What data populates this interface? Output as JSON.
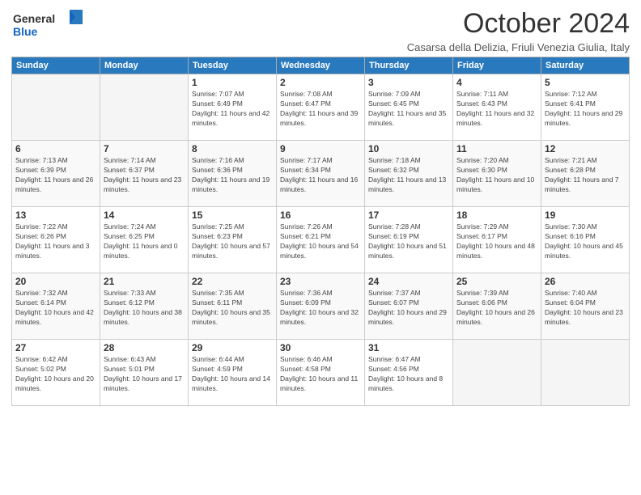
{
  "logo": {
    "general": "General",
    "blue": "Blue"
  },
  "title": "October 2024",
  "location": "Casarsa della Delizia, Friuli Venezia Giulia, Italy",
  "days_of_week": [
    "Sunday",
    "Monday",
    "Tuesday",
    "Wednesday",
    "Thursday",
    "Friday",
    "Saturday"
  ],
  "weeks": [
    [
      {
        "day": "",
        "sunrise": "",
        "sunset": "",
        "daylight": "",
        "empty": true
      },
      {
        "day": "",
        "sunrise": "",
        "sunset": "",
        "daylight": "",
        "empty": true
      },
      {
        "day": "1",
        "sunrise": "Sunrise: 7:07 AM",
        "sunset": "Sunset: 6:49 PM",
        "daylight": "Daylight: 11 hours and 42 minutes."
      },
      {
        "day": "2",
        "sunrise": "Sunrise: 7:08 AM",
        "sunset": "Sunset: 6:47 PM",
        "daylight": "Daylight: 11 hours and 39 minutes."
      },
      {
        "day": "3",
        "sunrise": "Sunrise: 7:09 AM",
        "sunset": "Sunset: 6:45 PM",
        "daylight": "Daylight: 11 hours and 35 minutes."
      },
      {
        "day": "4",
        "sunrise": "Sunrise: 7:11 AM",
        "sunset": "Sunset: 6:43 PM",
        "daylight": "Daylight: 11 hours and 32 minutes."
      },
      {
        "day": "5",
        "sunrise": "Sunrise: 7:12 AM",
        "sunset": "Sunset: 6:41 PM",
        "daylight": "Daylight: 11 hours and 29 minutes."
      }
    ],
    [
      {
        "day": "6",
        "sunrise": "Sunrise: 7:13 AM",
        "sunset": "Sunset: 6:39 PM",
        "daylight": "Daylight: 11 hours and 26 minutes."
      },
      {
        "day": "7",
        "sunrise": "Sunrise: 7:14 AM",
        "sunset": "Sunset: 6:37 PM",
        "daylight": "Daylight: 11 hours and 23 minutes."
      },
      {
        "day": "8",
        "sunrise": "Sunrise: 7:16 AM",
        "sunset": "Sunset: 6:36 PM",
        "daylight": "Daylight: 11 hours and 19 minutes."
      },
      {
        "day": "9",
        "sunrise": "Sunrise: 7:17 AM",
        "sunset": "Sunset: 6:34 PM",
        "daylight": "Daylight: 11 hours and 16 minutes."
      },
      {
        "day": "10",
        "sunrise": "Sunrise: 7:18 AM",
        "sunset": "Sunset: 6:32 PM",
        "daylight": "Daylight: 11 hours and 13 minutes."
      },
      {
        "day": "11",
        "sunrise": "Sunrise: 7:20 AM",
        "sunset": "Sunset: 6:30 PM",
        "daylight": "Daylight: 11 hours and 10 minutes."
      },
      {
        "day": "12",
        "sunrise": "Sunrise: 7:21 AM",
        "sunset": "Sunset: 6:28 PM",
        "daylight": "Daylight: 11 hours and 7 minutes."
      }
    ],
    [
      {
        "day": "13",
        "sunrise": "Sunrise: 7:22 AM",
        "sunset": "Sunset: 6:26 PM",
        "daylight": "Daylight: 11 hours and 3 minutes."
      },
      {
        "day": "14",
        "sunrise": "Sunrise: 7:24 AM",
        "sunset": "Sunset: 6:25 PM",
        "daylight": "Daylight: 11 hours and 0 minutes."
      },
      {
        "day": "15",
        "sunrise": "Sunrise: 7:25 AM",
        "sunset": "Sunset: 6:23 PM",
        "daylight": "Daylight: 10 hours and 57 minutes."
      },
      {
        "day": "16",
        "sunrise": "Sunrise: 7:26 AM",
        "sunset": "Sunset: 6:21 PM",
        "daylight": "Daylight: 10 hours and 54 minutes."
      },
      {
        "day": "17",
        "sunrise": "Sunrise: 7:28 AM",
        "sunset": "Sunset: 6:19 PM",
        "daylight": "Daylight: 10 hours and 51 minutes."
      },
      {
        "day": "18",
        "sunrise": "Sunrise: 7:29 AM",
        "sunset": "Sunset: 6:17 PM",
        "daylight": "Daylight: 10 hours and 48 minutes."
      },
      {
        "day": "19",
        "sunrise": "Sunrise: 7:30 AM",
        "sunset": "Sunset: 6:16 PM",
        "daylight": "Daylight: 10 hours and 45 minutes."
      }
    ],
    [
      {
        "day": "20",
        "sunrise": "Sunrise: 7:32 AM",
        "sunset": "Sunset: 6:14 PM",
        "daylight": "Daylight: 10 hours and 42 minutes."
      },
      {
        "day": "21",
        "sunrise": "Sunrise: 7:33 AM",
        "sunset": "Sunset: 6:12 PM",
        "daylight": "Daylight: 10 hours and 38 minutes."
      },
      {
        "day": "22",
        "sunrise": "Sunrise: 7:35 AM",
        "sunset": "Sunset: 6:11 PM",
        "daylight": "Daylight: 10 hours and 35 minutes."
      },
      {
        "day": "23",
        "sunrise": "Sunrise: 7:36 AM",
        "sunset": "Sunset: 6:09 PM",
        "daylight": "Daylight: 10 hours and 32 minutes."
      },
      {
        "day": "24",
        "sunrise": "Sunrise: 7:37 AM",
        "sunset": "Sunset: 6:07 PM",
        "daylight": "Daylight: 10 hours and 29 minutes."
      },
      {
        "day": "25",
        "sunrise": "Sunrise: 7:39 AM",
        "sunset": "Sunset: 6:06 PM",
        "daylight": "Daylight: 10 hours and 26 minutes."
      },
      {
        "day": "26",
        "sunrise": "Sunrise: 7:40 AM",
        "sunset": "Sunset: 6:04 PM",
        "daylight": "Daylight: 10 hours and 23 minutes."
      }
    ],
    [
      {
        "day": "27",
        "sunrise": "Sunrise: 6:42 AM",
        "sunset": "Sunset: 5:02 PM",
        "daylight": "Daylight: 10 hours and 20 minutes."
      },
      {
        "day": "28",
        "sunrise": "Sunrise: 6:43 AM",
        "sunset": "Sunset: 5:01 PM",
        "daylight": "Daylight: 10 hours and 17 minutes."
      },
      {
        "day": "29",
        "sunrise": "Sunrise: 6:44 AM",
        "sunset": "Sunset: 4:59 PM",
        "daylight": "Daylight: 10 hours and 14 minutes."
      },
      {
        "day": "30",
        "sunrise": "Sunrise: 6:46 AM",
        "sunset": "Sunset: 4:58 PM",
        "daylight": "Daylight: 10 hours and 11 minutes."
      },
      {
        "day": "31",
        "sunrise": "Sunrise: 6:47 AM",
        "sunset": "Sunset: 4:56 PM",
        "daylight": "Daylight: 10 hours and 8 minutes."
      },
      {
        "day": "",
        "sunrise": "",
        "sunset": "",
        "daylight": "",
        "empty": true
      },
      {
        "day": "",
        "sunrise": "",
        "sunset": "",
        "daylight": "",
        "empty": true
      }
    ]
  ]
}
